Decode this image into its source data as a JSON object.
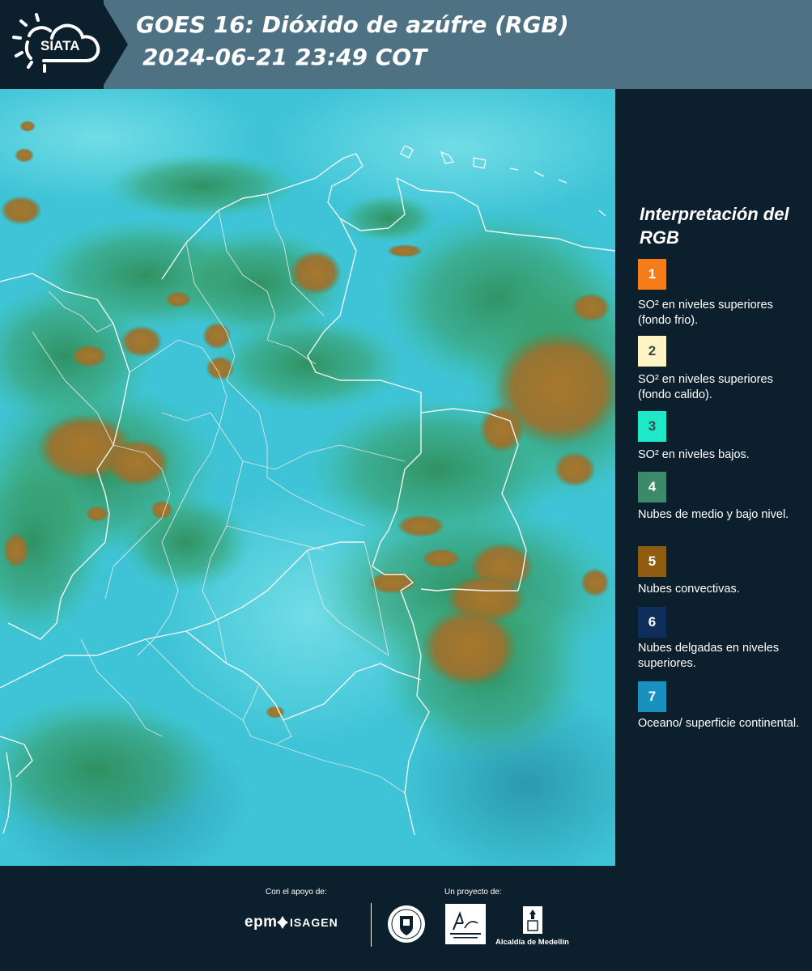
{
  "header": {
    "logo_text": "SIATA",
    "title_line1": "GOES 16: Dióxido de azúfre (RGB)",
    "title_line2": "2024-06-21 23:49 COT"
  },
  "legend": {
    "title": "Interpretación del RGB",
    "items": [
      {
        "number": "1",
        "color": "#f47d1a",
        "text": "SO² en niveles superiores (fondo frio)."
      },
      {
        "number": "2",
        "color": "#fdf3c3",
        "text": "SO² en niveles superiores (fondo calido)."
      },
      {
        "number": "3",
        "color": "#1fe8c8",
        "text": "SO² en niveles bajos."
      },
      {
        "number": "4",
        "color": "#3c8a6a",
        "text": "Nubes de medio y bajo nivel."
      },
      {
        "number": "5",
        "color": "#8f5c12",
        "text": "Nubes convectivas."
      },
      {
        "number": "6",
        "color": "#0f2f5a",
        "text": "Nubes delgadas en niveles superiores."
      },
      {
        "number": "7",
        "color": "#1890c0",
        "text": "Oceano/ superficie continental."
      }
    ]
  },
  "footer": {
    "support_label": "Con el apoyo de:",
    "project_label": "Un proyecto de:",
    "sponsors": [
      "epm",
      "ISAGEN"
    ],
    "alcaldia_label": "Alcaldía de Medellín"
  },
  "colors": {
    "background": "#0c1f2d",
    "header_band": "#4e7283",
    "map_base": "#3ec4d6",
    "clouds_low": "#3f9a6a",
    "clouds_convective": "#a8782a"
  }
}
